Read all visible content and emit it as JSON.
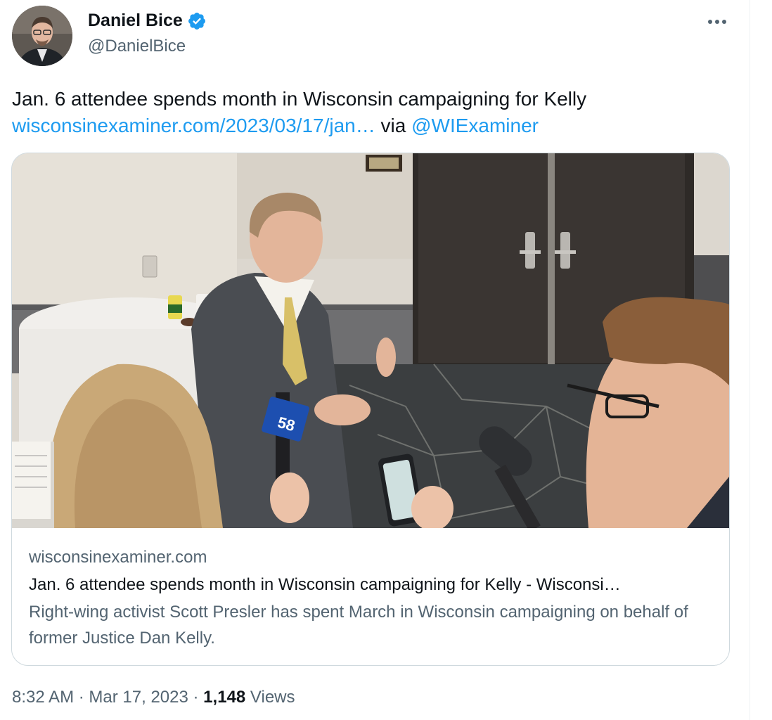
{
  "author": {
    "name": "Daniel Bice",
    "handle": "@DanielBice",
    "verified_color": "#1d9bf0"
  },
  "menu_icon": "more-horizontal-icon",
  "tweet": {
    "text": "Jan. 6 attendee spends month in Wisconsin campaigning for Kelly",
    "link": "wisconsinexaminer.com/2023/03/17/jan…",
    "via": "via",
    "mention": "@WIExaminer"
  },
  "card": {
    "domain": "wisconsinexaminer.com",
    "title": "Jan. 6 attendee spends month in Wisconsin campaigning for Kelly - Wisconsi…",
    "description": "Right-wing activist Scott Presler has spent March in Wisconsin campaigning on behalf of former Justice Dan Kelly.",
    "mic_flag_label": "58"
  },
  "meta": {
    "time": "8:32 AM",
    "separator": "·",
    "date": "Mar 17, 2023",
    "views_count": "1,148",
    "views_label": "Views"
  },
  "colors": {
    "link": "#1d9bf0",
    "secondary_text": "#536471",
    "primary_text": "#0f1419",
    "border": "#cfd9de"
  }
}
